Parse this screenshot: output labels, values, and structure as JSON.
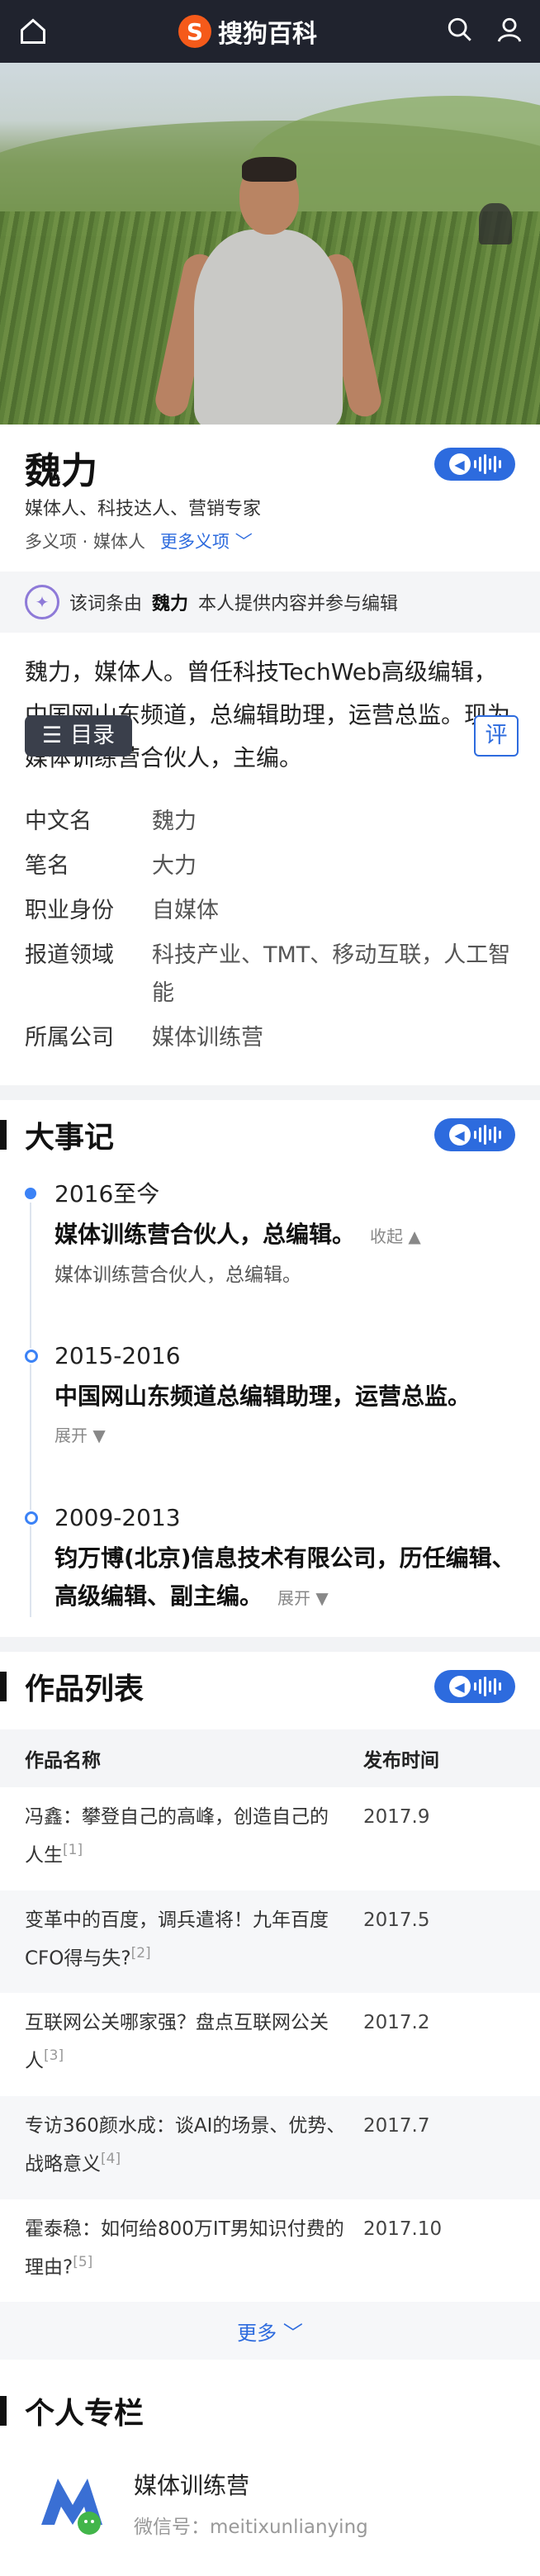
{
  "header": {
    "logo_letter": "S",
    "logo_text": "搜狗百科",
    "icons": [
      "home-icon",
      "search-icon",
      "user-icon"
    ]
  },
  "entry": {
    "title": "魏力",
    "subtitle": "媒体人、科技达人、营销专家",
    "meaning": "多义项 · 媒体人",
    "more_meanings": "更多义项",
    "contributor_text_1": "该词条由",
    "contributor_name": "魏力",
    "contributor_text_2": "本人提供内容并参与编辑",
    "summary": "魏力，媒体人。曾任科技TechWeb高级编辑，中国网山东频道，总编辑助理，运营总监。现为媒体训练营合伙人，主编。",
    "toc_label": "目录",
    "review_label": "评"
  },
  "infobox": [
    {
      "key": "中文名",
      "value": "魏力"
    },
    {
      "key": "笔名",
      "value": "大力"
    },
    {
      "key": "职业身份",
      "value": "自媒体"
    },
    {
      "key": "报道领域",
      "value": "科技产业、TMT、移动互联，人工智能"
    },
    {
      "key": "所属公司",
      "value": "媒体训练营"
    }
  ],
  "events": {
    "section_title": "大事记",
    "items": [
      {
        "year": "2016至今",
        "title": "媒体训练营合伙人，总编辑。",
        "toggle": "收起 ▲",
        "desc": "媒体训练营合伙人，总编辑。"
      },
      {
        "year": "2015-2016",
        "title": "中国网山东频道总编辑助理，运营总监。",
        "toggle": "展开 ▼"
      },
      {
        "year": "2009-2013",
        "title": "钧万博(北京)信息技术有限公司，历任编辑、高级编辑、副主编。",
        "toggle": "展开 ▼"
      }
    ]
  },
  "works": {
    "section_title": "作品列表",
    "col_name": "作品名称",
    "col_time": "发布时间",
    "rows": [
      {
        "name": "冯鑫：攀登自己的高峰，创造自己的人生",
        "ref": "[1]",
        "time": "2017.9"
      },
      {
        "name": "变革中的百度，调兵遣将！九年百度CFO得与失?",
        "ref": "[2]",
        "time": "2017.5"
      },
      {
        "name": "互联网公关哪家强？盘点互联网公关人",
        "ref": "[3]",
        "time": "2017.2"
      },
      {
        "name": "专访360颜水成：谈AI的场景、优势、战略意义",
        "ref": "[4]",
        "time": "2017.7"
      },
      {
        "name": "霍泰稳：如何给800万IT男知识付费的理由?",
        "ref": "[5]",
        "time": "2017.10"
      }
    ],
    "more": "更多"
  },
  "column": {
    "section_title": "个人专栏",
    "name": "媒体训练营",
    "wechat": "微信号：meitixunlianying"
  },
  "colors": {
    "header_bg": "#20232e",
    "accent": "#2d6bde",
    "logo": "#f55a1a"
  }
}
